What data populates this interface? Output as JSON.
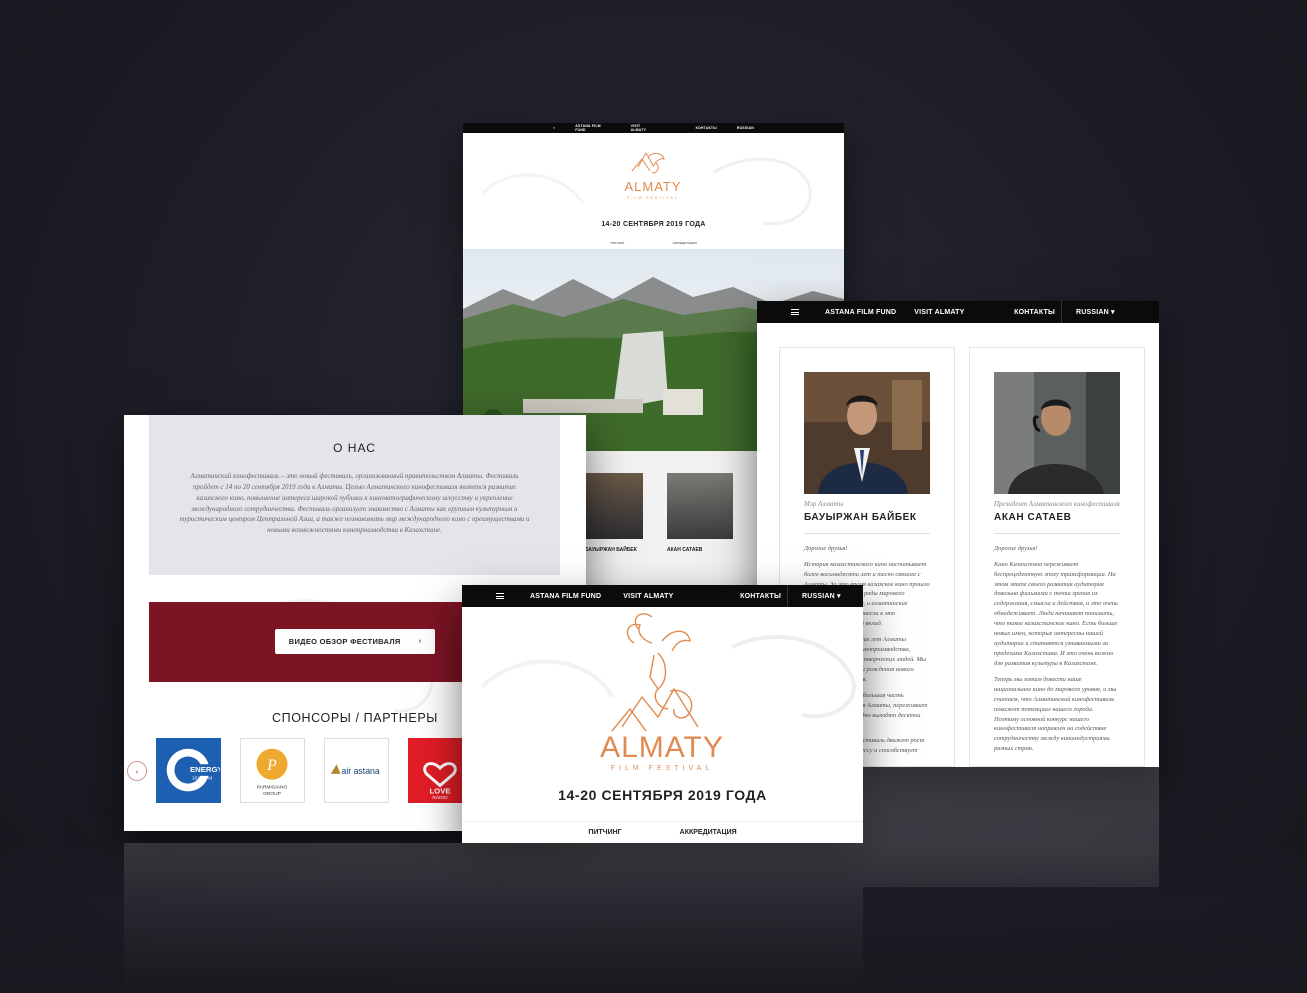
{
  "cardA": {
    "nav": [
      "≡",
      "ASTANA FILM FUND",
      "VISIT ALMATY",
      "КОНТАКТЫ",
      "RUSSIAN"
    ],
    "logo": {
      "name": "ALMATY",
      "sub": "FILM FESTIVAL"
    },
    "date": "14-20 СЕНТЯБРЯ 2019 ГОДА",
    "subnav": [
      "ПИТЧИНГ",
      "АККРЕДИТАЦИЯ"
    ],
    "person1": "БАУЫРЖАН БАЙБЕК",
    "person2": "АКАН САТАЕВ"
  },
  "cardB": {
    "nav": {
      "fund": "ASTANA FILM FUND",
      "visit": "VISIT ALMATY",
      "contacts": "КОНТАКТЫ",
      "lang": "RUSSIAN ▾"
    },
    "persons": [
      {
        "role": "Мэр Алматы",
        "name": "БАУЫРЖАН БАЙБЕК",
        "greeting": "Дорогие друзья!",
        "paragraphs": [
          "История казахстанского кино насчитывает более восьмидесяти лет и тесно связана с Алматы. За это время казахское кино прошло яркий путь, пополнив ряды мирового культурного наследия, и алматинские кинематографисты внесли в это достижение немалый вклад.",
          "На протяжении многих лет Алматы остается центром кинопроизводства, местом притяжения творческих людей. Мы являемся свидетелями рождения нового поколения режиссеров.",
          "Казахстанское кино, большая часть которого снимается в Алматы, переживает возрождение. Ежегодно выходят десятки фильмов.",
          "Алматинский кинофестиваль движет рост интереса к кинопроцессу и способствует созданию"
        ]
      },
      {
        "role": "Президент Алматинского кинофестиваля",
        "name": "АКАН САТАЕВ",
        "greeting": "Дорогие друзья!",
        "paragraphs": [
          "Кино Казахстана переживает беспрецедентную эпоху трансформации. На этом этапе своего развития аудитория довольна фильмами с точки зрения их содержания, смысла и действия, и это очень обнадеживает. Люди начинают понимать, что такое казахстанское кино. Есть больше новых имен, которые интересны нашей аудитории и становятся узнаваемыми за пределами Казахстана. И это очень важно для развития культуры в Казахстане.",
          "Теперь мы хотим довести наше национальное кино до мирового уровня, и мы считаем, что Алматинский кинофестиваль покажет потенциал нашего города. Поэтому основной конкурс нашего кинофестиваля направлен на содействие сотрудничеству между кинoиндустриями разных стран."
        ]
      }
    ]
  },
  "cardC": {
    "about_title": "О НАС",
    "about_text": "Алматинский кинофестиваль – это новый фестиваль, организованный правительством Алматы. Фестиваль пройдет с 14 по 20 сентября 2019 года в Алматы. Целью Алматинского кинофестиваля является развитие казахского кино, повышение интереса широкой публики к кинематографическому искусству и укрепление международного сотрудничества. Фестиваль организует знакомство с Алматы как крупным культурным и туристическим центром Центральной Азии, а также познакомить мир международного кино с преимуществами и новыми возможностями кинопроизводства в Казахстане.",
    "video_button": "ВИДЕО ОБЗОР ФЕСТИВАЛЯ",
    "sponsors_title": "СПОНСОРЫ / ПАРТНЕРЫ",
    "sponsors": [
      {
        "name": "ENERGY",
        "freq": "102,2 FM"
      },
      {
        "name": "PARMIGIANO",
        "sub": "GROUP"
      },
      {
        "name": "air astana"
      },
      {
        "name": "LOVE",
        "sub": "RADIO",
        "sub2": "KAZAKHSTAN"
      }
    ]
  },
  "cardD": {
    "nav": {
      "fund": "ASTANA FILM FUND",
      "visit": "VISIT ALMATY",
      "contacts": "КОНТАКТЫ",
      "lang": "RUSSIAN ▾"
    },
    "logo": {
      "name": "ALMATY",
      "sub": "FILM FESTIVAL"
    },
    "date": "14-20 СЕНТЯБРЯ 2019 ГОДА",
    "subnav": {
      "pitching": "ПИТЧИНГ",
      "accreditation": "АККРЕДИТАЦИЯ"
    }
  },
  "colors": {
    "accent": "#e08a50",
    "burgundy": "#7c1424",
    "nav": "#0b0b0b",
    "about_bg": "#e4e4ea"
  }
}
